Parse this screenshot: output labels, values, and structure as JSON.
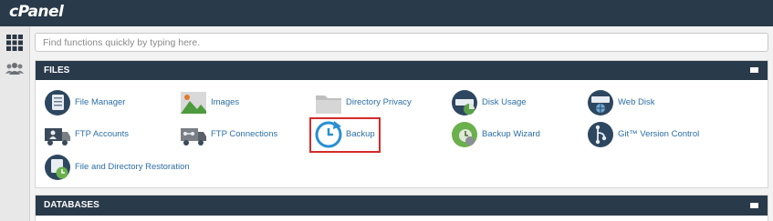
{
  "brand": {
    "logo": "cPanel"
  },
  "search": {
    "placeholder": "Find functions quickly by typing here."
  },
  "sections": {
    "files": {
      "title": "FILES",
      "items": [
        {
          "label": "File Manager",
          "icon": "file-manager-icon"
        },
        {
          "label": "Images",
          "icon": "images-icon"
        },
        {
          "label": "Directory Privacy",
          "icon": "folder-icon"
        },
        {
          "label": "Disk Usage",
          "icon": "disk-usage-icon"
        },
        {
          "label": "Web Disk",
          "icon": "web-disk-icon"
        },
        {
          "label": "FTP Accounts",
          "icon": "ftp-accounts-icon"
        },
        {
          "label": "FTP Connections",
          "icon": "ftp-connections-icon"
        },
        {
          "label": "Backup",
          "icon": "backup-icon"
        },
        {
          "label": "Backup Wizard",
          "icon": "backup-wizard-icon"
        },
        {
          "label": "Git™ Version Control",
          "icon": "git-icon"
        },
        {
          "label": "File and Directory Restoration",
          "icon": "restore-icon"
        }
      ]
    },
    "databases": {
      "title": "DATABASES"
    }
  },
  "colors": {
    "header": "#293a4a",
    "link": "#2b6ea6",
    "highlight": "#d42a2a"
  }
}
